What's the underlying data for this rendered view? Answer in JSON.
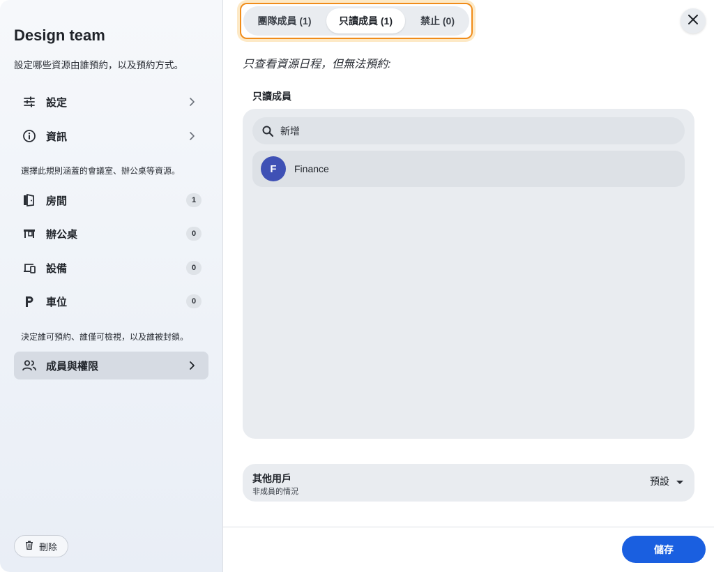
{
  "sidebar": {
    "title": "Design team",
    "subtitle": "設定哪些資源由誰預約，以及預約方式。",
    "nav_top": [
      {
        "label": "設定",
        "icon": "sliders-icon"
      },
      {
        "label": "資訊",
        "icon": "info-icon"
      }
    ],
    "resources_note": "選擇此規則涵蓋的會議室、辦公桌等資源。",
    "resources": [
      {
        "label": "房間",
        "icon": "door-icon",
        "count": "1"
      },
      {
        "label": "辦公桌",
        "icon": "desk-icon",
        "count": "0"
      },
      {
        "label": "設備",
        "icon": "devices-icon",
        "count": "0"
      },
      {
        "label": "車位",
        "icon": "parking-icon",
        "count": "0"
      }
    ],
    "permissions_note": "決定誰可預約、誰僅可檢視，以及誰被封鎖。",
    "members_item": {
      "label": "成員與權限",
      "icon": "people-icon"
    },
    "delete_label": "刪除"
  },
  "tabs": [
    {
      "label": "團隊成員 (1)",
      "active": false
    },
    {
      "label": "只讀成員 (1)",
      "active": true
    },
    {
      "label": "禁止 (0)",
      "active": false
    }
  ],
  "description": "只查看資源日程，但無法預約:",
  "section_title": "只讀成員",
  "search": {
    "placeholder": "新增"
  },
  "members": [
    {
      "initial": "F",
      "name": "Finance",
      "avatar_color": "#3f51b5"
    }
  ],
  "others": {
    "title": "其他用戶",
    "subtitle": "非成員的情況",
    "value": "預設"
  },
  "save_label": "儲存",
  "colors": {
    "accent": "#1a5fe0",
    "highlight": "#f08c1a"
  }
}
